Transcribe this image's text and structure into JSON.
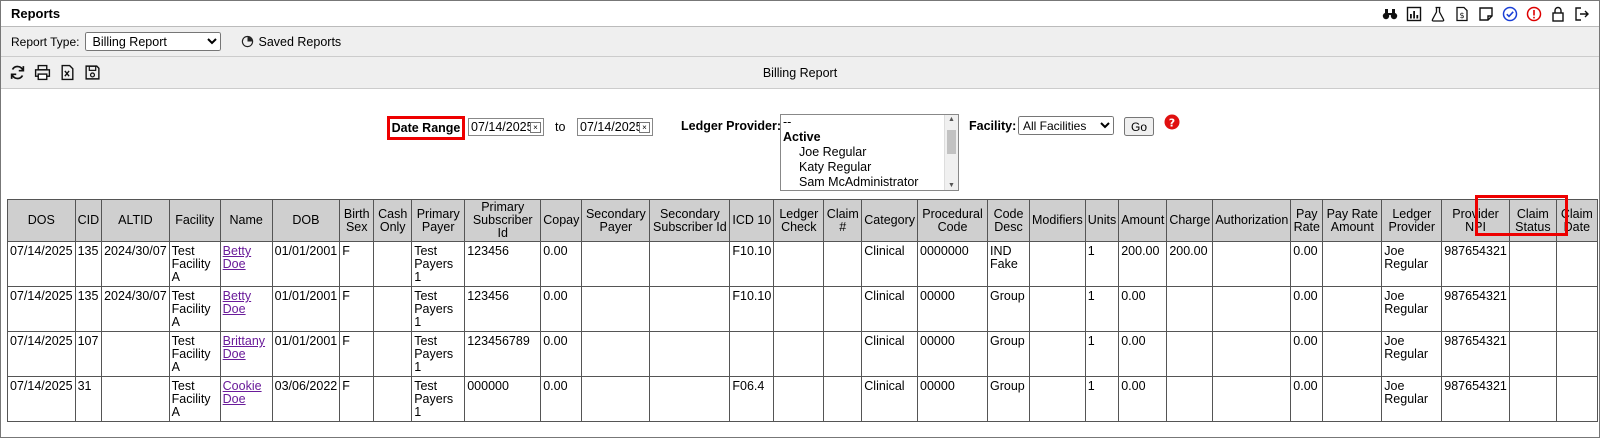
{
  "window": {
    "title": "Reports"
  },
  "top_icons": [
    "binoculars-icon",
    "bar-chart-icon",
    "flask-icon",
    "document-dollar-icon",
    "note-icon",
    "check-circle-icon",
    "info-alert-icon",
    "lock-icon",
    "logout-icon"
  ],
  "report_type": {
    "label": "Report Type:",
    "selected": "Billing Report",
    "saved_label": "Saved Reports"
  },
  "toolbar": {
    "title": "Billing Report"
  },
  "filters": {
    "date_range_label": "Date Range",
    "date_from": "07/14/2025",
    "to_label": "to",
    "date_to": "07/14/2025",
    "ledger_provider_label": "Ledger Provider:",
    "ledger_options": [
      "--",
      "Active",
      "Joe Regular",
      "Katy Regular",
      "Sam McAdministrator"
    ],
    "facility_label": "Facility:",
    "facility_selected": "All Facilities",
    "go_label": "Go"
  },
  "table": {
    "headers": [
      "DOS",
      "CID",
      "ALTID",
      "Facility",
      "Name",
      "DOB",
      "Birth Sex",
      "Cash Only",
      "Primary Payer",
      "Primary Subscriber Id",
      "Copay",
      "Secondary Payer",
      "Secondary Subscriber Id",
      "ICD 10",
      "Ledger Check",
      "Claim #",
      "Category",
      "Procedural Code",
      "Code Desc",
      "Modifiers",
      "Units",
      "Amount",
      "Charge",
      "Authorization",
      "Pay Rate",
      "Pay Rate Amount",
      "Ledger Provider",
      "Provider NPI",
      "Claim Status",
      "Claim Date"
    ],
    "rows": [
      [
        "07/14/2025",
        "135",
        "2024/30/07",
        "Test Facility A",
        "Betty Doe",
        "01/01/2001",
        "F",
        "",
        "Test Payers 1",
        "123456",
        "0.00",
        "",
        "",
        "F10.10",
        "",
        "",
        "Clinical",
        "0000000",
        "IND Fake",
        "",
        "1",
        "200.00",
        "200.00",
        "",
        "0.00",
        "",
        "Joe Regular",
        "987654321",
        "",
        ""
      ],
      [
        "07/14/2025",
        "135",
        "2024/30/07",
        "Test Facility A",
        "Betty Doe",
        "01/01/2001",
        "F",
        "",
        "Test Payers 1",
        "123456",
        "0.00",
        "",
        "",
        "F10.10",
        "",
        "",
        "Clinical",
        "00000",
        "Group",
        "",
        "1",
        "0.00",
        "",
        "",
        "0.00",
        "",
        "Joe Regular",
        "987654321",
        "",
        ""
      ],
      [
        "07/14/2025",
        "107",
        "",
        "Test Facility A",
        "Brittany Doe",
        "01/01/2001",
        "F",
        "",
        "Test Payers 1",
        "123456789",
        "0.00",
        "",
        "",
        "",
        "",
        "",
        "Clinical",
        "00000",
        "Group",
        "",
        "1",
        "0.00",
        "",
        "",
        "0.00",
        "",
        "Joe Regular",
        "987654321",
        "",
        ""
      ],
      [
        "07/14/2025",
        "31",
        "",
        "Test Facility A",
        "Cookie Doe",
        "03/06/2022",
        "F",
        "",
        "Test Payers 1",
        "000000",
        "0.00",
        "",
        "",
        "F06.4",
        "",
        "",
        "Clinical",
        "00000",
        "Group",
        "",
        "1",
        "0.00",
        "",
        "",
        "0.00",
        "",
        "Joe Regular",
        "987654321",
        "",
        ""
      ]
    ]
  }
}
